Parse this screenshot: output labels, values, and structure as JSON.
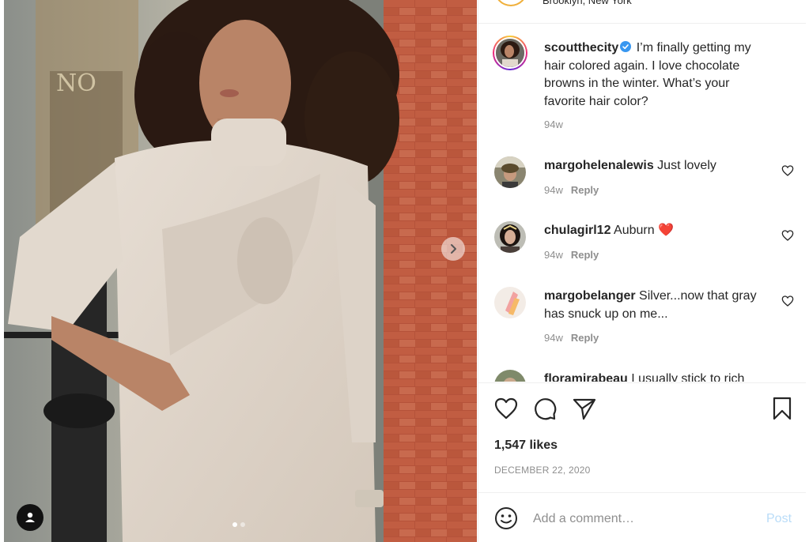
{
  "post": {
    "location": "Brooklyn, New York",
    "caption": {
      "username": "scoutthecity",
      "verified": true,
      "text": "I’m finally getting my hair colored again. I love chocolate browns in the winter. What’s your favorite hair color?",
      "time": "94w"
    },
    "comments": [
      {
        "username": "margohelenalewis",
        "text": "Just lovely",
        "time": "94w",
        "reply_label": "Reply"
      },
      {
        "username": "chulagirl12",
        "text": "Auburn",
        "emoji": "❤️",
        "time": "94w",
        "reply_label": "Reply"
      },
      {
        "username": "margobelanger",
        "text": "Silver...now that gray has snuck up on me...",
        "time": "94w",
        "reply_label": "Reply"
      },
      {
        "username": "floramirabeau",
        "text": "I usually stick to rich"
      }
    ],
    "likes": "1,547 likes",
    "date": "DECEMBER 22, 2020",
    "comment_placeholder": "Add a comment…",
    "post_label": "Post"
  },
  "icons": {
    "next": "chevron-right-icon",
    "tag": "user-tag-icon",
    "like": "heart-icon",
    "comment": "comment-icon",
    "share": "paper-plane-icon",
    "save": "bookmark-icon",
    "emoji": "smiley-icon",
    "verified": "verified-badge-icon"
  },
  "colors": {
    "link_disabled": "#b9dcf8",
    "verified": "#3897f0",
    "heart_emoji": "#e0245e",
    "muted_text": "#8e8e8e"
  }
}
